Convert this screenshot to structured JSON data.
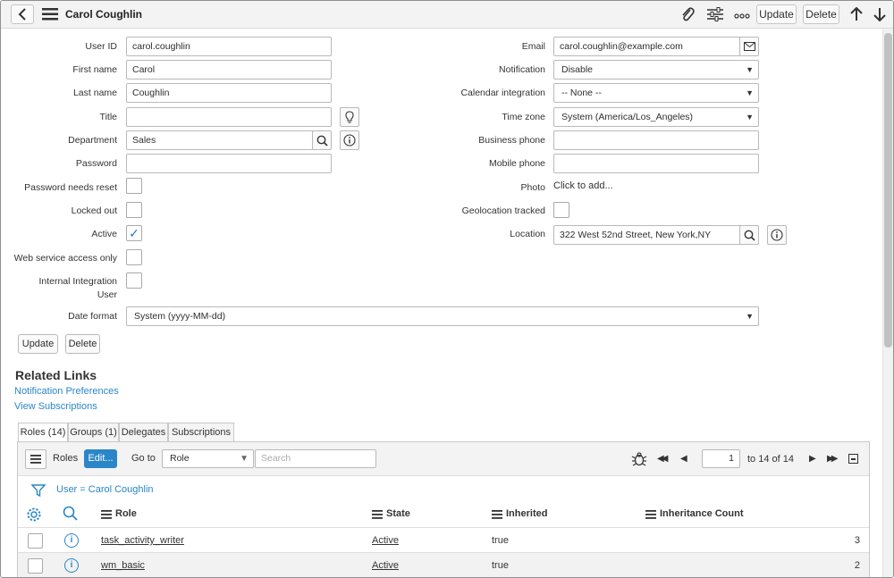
{
  "header": {
    "title": "Carol Coughlin",
    "back_icon": "‹",
    "update_label": "Update",
    "delete_label": "Delete"
  },
  "form": {
    "user_id": {
      "label": "User ID",
      "value": "carol.coughlin"
    },
    "first_name": {
      "label": "First name",
      "value": "Carol"
    },
    "last_name": {
      "label": "Last name",
      "value": "Coughlin"
    },
    "title": {
      "label": "Title",
      "value": ""
    },
    "department": {
      "label": "Department",
      "value": "Sales"
    },
    "password": {
      "label": "Password",
      "value": ""
    },
    "password_reset": {
      "label": "Password needs reset",
      "checked": false
    },
    "locked_out": {
      "label": "Locked out",
      "checked": false
    },
    "active": {
      "label": "Active",
      "checked": true,
      "mark": "✓"
    },
    "web_service": {
      "label": "Web service access only",
      "checked": false
    },
    "internal_user": {
      "label_line1": "Internal Integration",
      "label_line2": "User",
      "checked": false
    },
    "date_format": {
      "label": "Date format",
      "value": "System (yyyy-MM-dd)"
    },
    "email": {
      "label": "Email",
      "value": "carol.coughlin@example.com"
    },
    "notification": {
      "label": "Notification",
      "value": "Disable"
    },
    "calendar": {
      "label": "Calendar integration",
      "value": "-- None --"
    },
    "time_zone": {
      "label": "Time zone",
      "value": "System (America/Los_Angeles)"
    },
    "business_phone": {
      "label": "Business phone",
      "value": ""
    },
    "mobile_phone": {
      "label": "Mobile phone",
      "value": ""
    },
    "photo": {
      "label": "Photo",
      "value": "Click to add..."
    },
    "geolocation": {
      "label": "Geolocation tracked",
      "checked": false
    },
    "location": {
      "label": "Location",
      "value": "322 West 52nd Street, New York,NY"
    },
    "update_label": "Update",
    "delete_label": "Delete"
  },
  "related": {
    "title": "Related Links",
    "links": [
      "Notification Preferences",
      "View Subscriptions"
    ]
  },
  "tabs": [
    "Roles (14)",
    "Groups (1)",
    "Delegates",
    "Subscriptions"
  ],
  "list": {
    "name": "Roles",
    "edit_label": "Edit...",
    "goto_label": "Go to",
    "goto_field": "Role",
    "search_placeholder": "Search",
    "page_input": "1",
    "page_info": "to 14 of 14",
    "filter_text": "User = Carol Coughlin",
    "columns": [
      "Role",
      "State",
      "Inherited",
      "Inheritance Count"
    ],
    "rows": [
      {
        "role": "task_activity_writer",
        "state": "Active",
        "inherited": "true",
        "count": "3"
      },
      {
        "role": "wm_basic",
        "state": "Active",
        "inherited": "true",
        "count": "2"
      }
    ]
  },
  "colors": {
    "link": "#2a86c8",
    "edit_button": "#2a86c8",
    "header_bg": "#f3f3f3"
  },
  "icons": {
    "back": "back-icon",
    "menu": "hamburger-menu-icon",
    "attach": "paperclip-icon",
    "settings": "sliders-icon",
    "more": "more-options-icon",
    "up": "arrow-up-icon",
    "down": "arrow-down-icon"
  }
}
